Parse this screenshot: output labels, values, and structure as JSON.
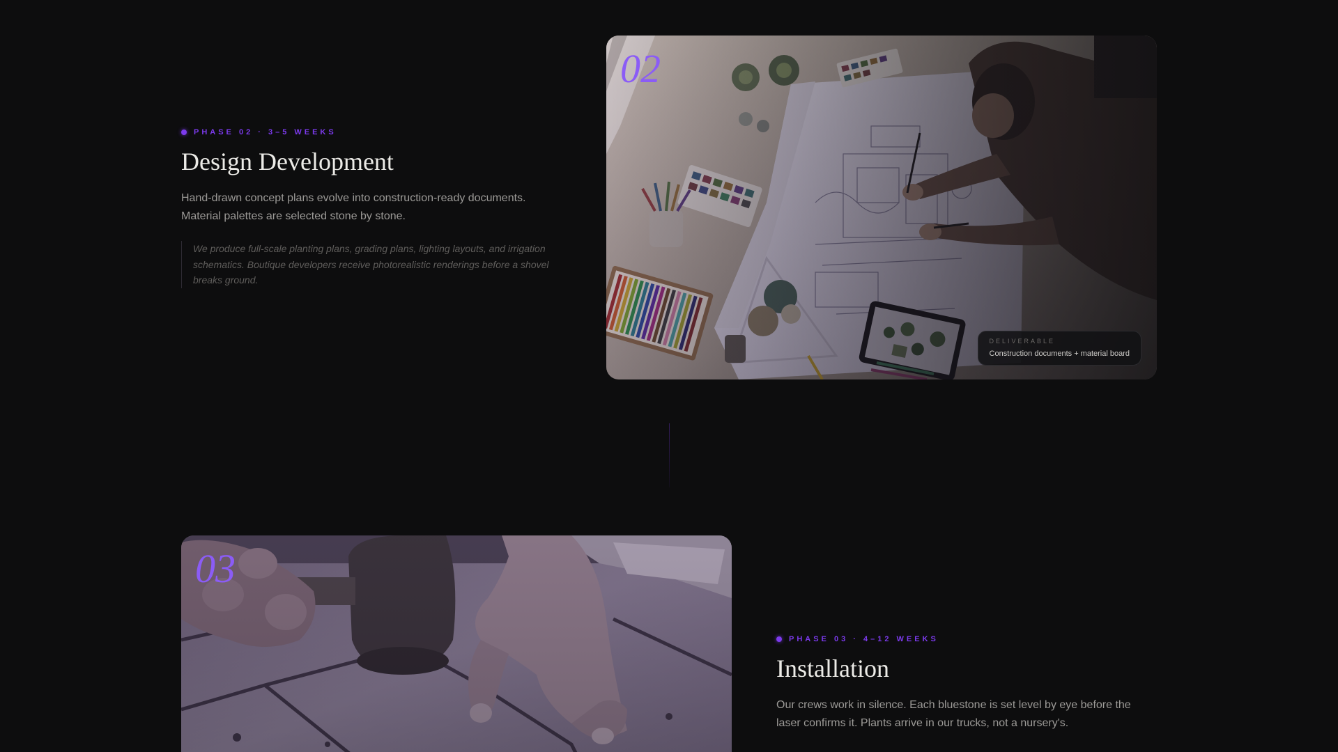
{
  "phases": [
    {
      "number": "02",
      "label": "PHASE 02 · 3–5 WEEKS",
      "title": "Design Development",
      "description": "Hand-drawn concept plans evolve into construction-ready documents. Material palettes are selected stone by stone.",
      "quote": "We produce full-scale planting plans, grading plans, lighting layouts, and irrigation schematics. Boutique developers receive photorealistic renderings before a shovel breaks ground.",
      "deliverable": {
        "label": "DELIVERABLE",
        "value": "Construction documents + material board"
      },
      "image_icon": "architect-drafting-photo"
    },
    {
      "number": "03",
      "label": "PHASE 03 · 4–12 WEEKS",
      "title": "Installation",
      "description": "Our crews work in silence. Each bluestone is set level by eye before the laser confirms it. Plants arrive in our trucks, not a nursery's.",
      "image_icon": "mallet-stone-photo"
    }
  ],
  "colors": {
    "background": "#0d0d0e",
    "accent": "#7c3aed",
    "number": "#8b5cf6",
    "title": "#ecebe7",
    "body": "#9c9a97",
    "quote": "#5f5d5b"
  }
}
